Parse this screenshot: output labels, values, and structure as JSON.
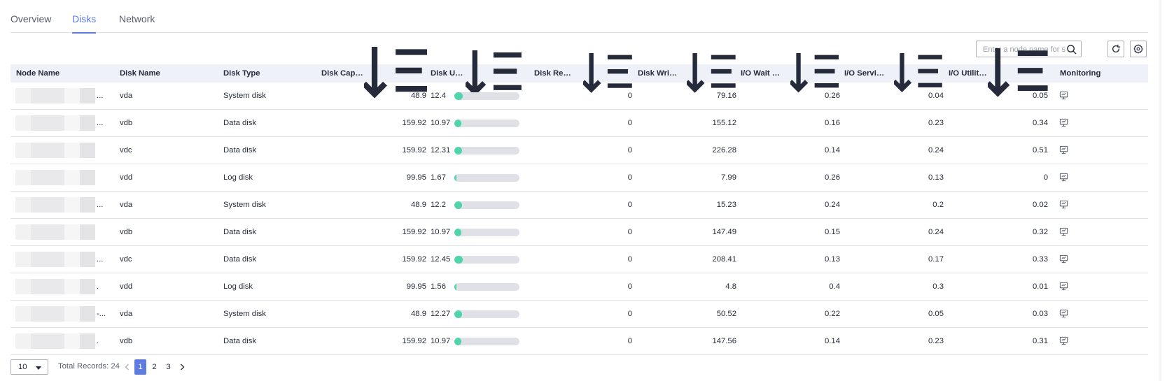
{
  "tabs": [
    {
      "label": "Overview",
      "active": false
    },
    {
      "label": "Disks",
      "active": true
    },
    {
      "label": "Network",
      "active": false
    }
  ],
  "toolbar": {
    "search_placeholder": "Enter a node name for search",
    "search_icon": "search-icon",
    "refresh_icon": "refresh-icon",
    "settings_icon": "gear-icon"
  },
  "table": {
    "columns": [
      {
        "label": "Node Name",
        "sortable": false
      },
      {
        "label": "Disk Name",
        "sortable": false
      },
      {
        "label": "Disk Type",
        "sortable": false
      },
      {
        "label": "Disk Capacity (GB)",
        "sortable": true
      },
      {
        "label": "Disk Usage (%)",
        "sortable": true
      },
      {
        "label": "Disk Read Rate (K...",
        "sortable": true
      },
      {
        "label": "Disk Write Rate (K...",
        "sortable": true
      },
      {
        "label": "I/O Wait Time (awa...",
        "sortable": true
      },
      {
        "label": "I/O Service Time (s...",
        "sortable": true
      },
      {
        "label": "I/O Utility (util, %)",
        "sortable": true
      },
      {
        "label": "Monitoring",
        "sortable": false
      }
    ],
    "rows": [
      {
        "node_suffix": "...",
        "disk_name": "vda",
        "disk_type": "System disk",
        "capacity": "48.9",
        "usage": "12.4",
        "usage_pct": 12.4,
        "read_rate": "0",
        "write_rate": "79.16",
        "wait_time": "0.26",
        "service_time": "0.04",
        "utility": "0.05"
      },
      {
        "node_suffix": "...",
        "disk_name": "vdb",
        "disk_type": "Data disk",
        "capacity": "159.92",
        "usage": "10.97",
        "usage_pct": 10.97,
        "read_rate": "0",
        "write_rate": "155.12",
        "wait_time": "0.16",
        "service_time": "0.23",
        "utility": "0.34"
      },
      {
        "node_suffix": "",
        "disk_name": "vdc",
        "disk_type": "Data disk",
        "capacity": "159.92",
        "usage": "12.31",
        "usage_pct": 12.31,
        "read_rate": "0",
        "write_rate": "226.28",
        "wait_time": "0.14",
        "service_time": "0.24",
        "utility": "0.51"
      },
      {
        "node_suffix": "",
        "disk_name": "vdd",
        "disk_type": "Log disk",
        "capacity": "99.95",
        "usage": "1.67",
        "usage_pct": 1.67,
        "read_rate": "0",
        "write_rate": "7.99",
        "wait_time": "0.26",
        "service_time": "0.13",
        "utility": "0"
      },
      {
        "node_suffix": "...",
        "disk_name": "vda",
        "disk_type": "System disk",
        "capacity": "48.9",
        "usage": "12.2",
        "usage_pct": 12.2,
        "read_rate": "0",
        "write_rate": "15.23",
        "wait_time": "0.24",
        "service_time": "0.2",
        "utility": "0.02"
      },
      {
        "node_suffix": "",
        "disk_name": "vdb",
        "disk_type": "Data disk",
        "capacity": "159.92",
        "usage": "10.97",
        "usage_pct": 10.97,
        "read_rate": "0",
        "write_rate": "147.49",
        "wait_time": "0.15",
        "service_time": "0.24",
        "utility": "0.32"
      },
      {
        "node_suffix": "...",
        "disk_name": "vdc",
        "disk_type": "Data disk",
        "capacity": "159.92",
        "usage": "12.45",
        "usage_pct": 12.45,
        "read_rate": "0",
        "write_rate": "208.41",
        "wait_time": "0.13",
        "service_time": "0.17",
        "utility": "0.33"
      },
      {
        "node_suffix": ".",
        "disk_name": "vdd",
        "disk_type": "Log disk",
        "capacity": "99.95",
        "usage": "1.56",
        "usage_pct": 1.56,
        "read_rate": "0",
        "write_rate": "4.8",
        "wait_time": "0.4",
        "service_time": "0.3",
        "utility": "0.01"
      },
      {
        "node_suffix": "-...",
        "disk_name": "vda",
        "disk_type": "System disk",
        "capacity": "48.9",
        "usage": "12.27",
        "usage_pct": 12.27,
        "read_rate": "0",
        "write_rate": "50.52",
        "wait_time": "0.22",
        "service_time": "0.05",
        "utility": "0.03"
      },
      {
        "node_suffix": ".",
        "disk_name": "vdb",
        "disk_type": "Data disk",
        "capacity": "159.92",
        "usage": "10.97",
        "usage_pct": 10.97,
        "read_rate": "0",
        "write_rate": "147.56",
        "wait_time": "0.14",
        "service_time": "0.23",
        "utility": "0.31"
      }
    ]
  },
  "pagination": {
    "page_size": "10",
    "total_label": "Total Records: 24",
    "pages": [
      "1",
      "2",
      "3"
    ],
    "current_page": "1"
  },
  "colors": {
    "accent": "#5e7ce0",
    "usage_fill": "#50d4ab",
    "usage_track": "#dfe1e6",
    "header_bg": "#eef1f7"
  }
}
